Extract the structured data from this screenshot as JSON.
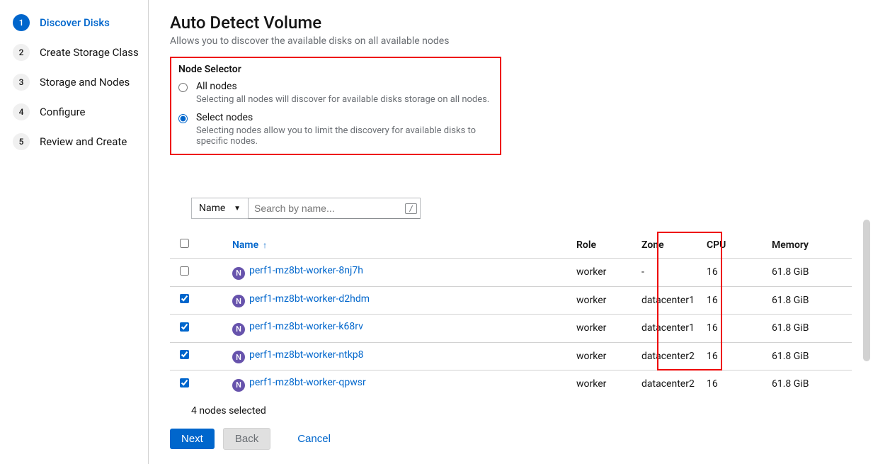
{
  "sidebar": {
    "steps": [
      {
        "num": "1",
        "label": "Discover Disks",
        "active": true
      },
      {
        "num": "2",
        "label": "Create Storage Class",
        "active": false
      },
      {
        "num": "3",
        "label": "Storage and Nodes",
        "active": false
      },
      {
        "num": "4",
        "label": "Configure",
        "active": false
      },
      {
        "num": "5",
        "label": "Review and Create",
        "active": false
      }
    ]
  },
  "page": {
    "title": "Auto Detect Volume",
    "subtitle": "Allows you to discover the available disks on all available nodes"
  },
  "node_selector": {
    "header": "Node Selector",
    "all_nodes_label": "All nodes",
    "all_nodes_desc": "Selecting all nodes will discover for available disks storage on all nodes.",
    "select_nodes_label": "Select nodes",
    "select_nodes_desc": "Selecting nodes allow you to limit the discovery for available disks to specific nodes."
  },
  "filter": {
    "type": "Name",
    "placeholder": "Search by name...",
    "kbd": "/"
  },
  "table": {
    "headers": {
      "name": "Name",
      "role": "Role",
      "zone": "Zone",
      "cpu": "CPU",
      "memory": "Memory"
    },
    "rows": [
      {
        "checked": false,
        "name": "perf1-mz8bt-worker-8nj7h",
        "role": "worker",
        "zone": "-",
        "cpu": "16",
        "memory": "61.8 GiB"
      },
      {
        "checked": true,
        "name": "perf1-mz8bt-worker-d2hdm",
        "role": "worker",
        "zone": "datacenter1",
        "cpu": "16",
        "memory": "61.8 GiB"
      },
      {
        "checked": true,
        "name": "perf1-mz8bt-worker-k68rv",
        "role": "worker",
        "zone": "datacenter1",
        "cpu": "16",
        "memory": "61.8 GiB"
      },
      {
        "checked": true,
        "name": "perf1-mz8bt-worker-ntkp8",
        "role": "worker",
        "zone": "datacenter2",
        "cpu": "16",
        "memory": "61.8 GiB"
      },
      {
        "checked": true,
        "name": "perf1-mz8bt-worker-qpwsr",
        "role": "worker",
        "zone": "datacenter2",
        "cpu": "16",
        "memory": "61.8 GiB"
      }
    ],
    "selected_text": "4 nodes selected"
  },
  "buttons": {
    "next": "Next",
    "back": "Back",
    "cancel": "Cancel"
  },
  "icons": {
    "node_badge": "N"
  }
}
